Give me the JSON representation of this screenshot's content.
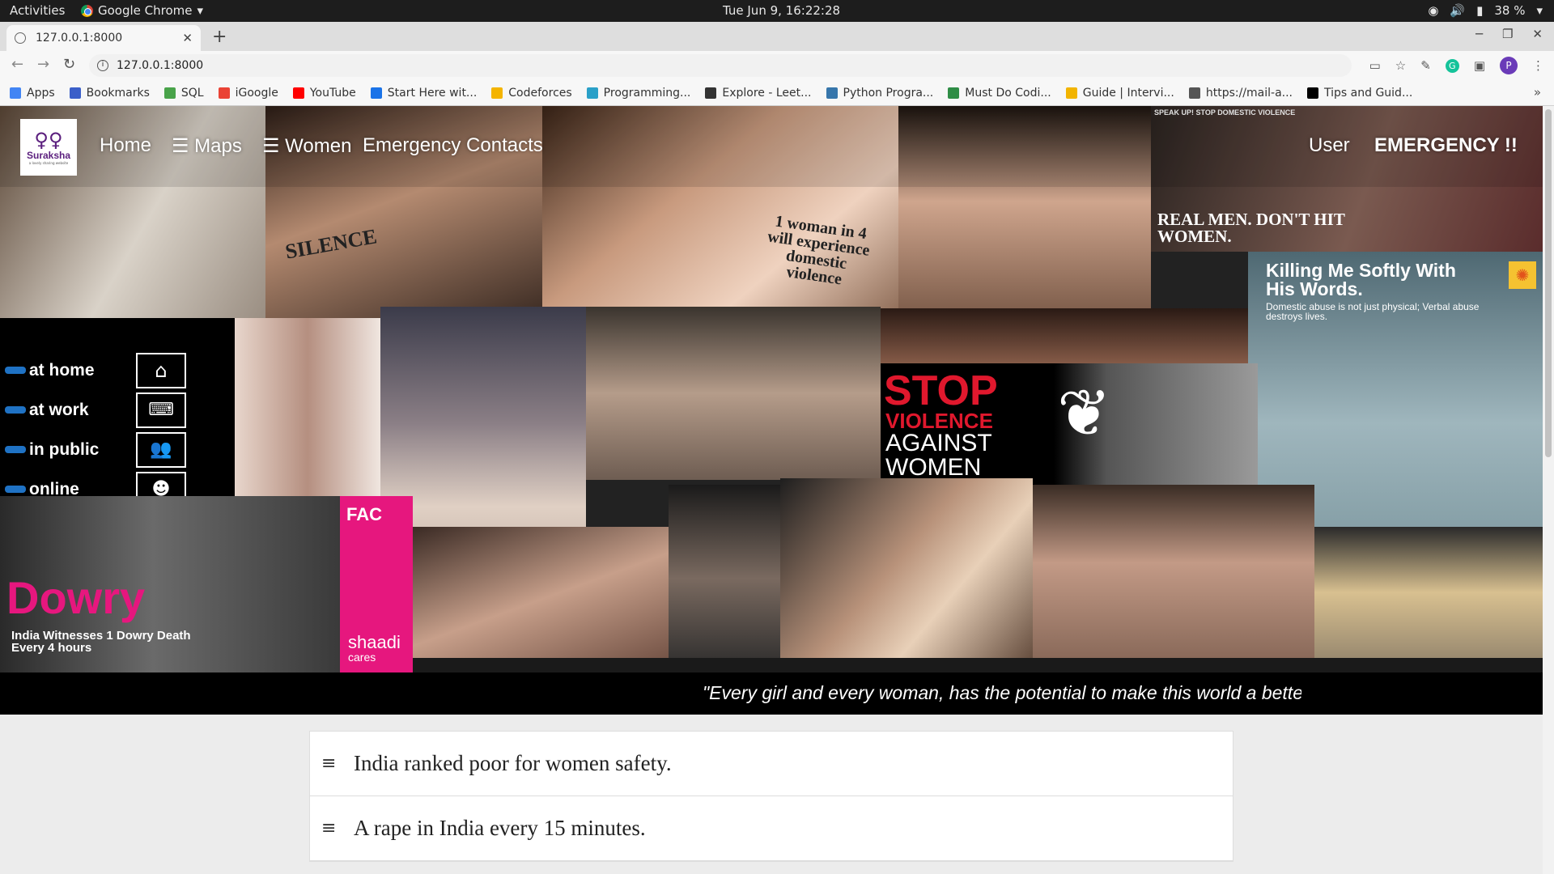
{
  "system_bar": {
    "activities": "Activities",
    "app_name": "Google Chrome",
    "clock": "Tue Jun  9, 16:22:28",
    "battery": "38 %"
  },
  "browser": {
    "tab_title": "127.0.0.1:8000",
    "url": "127.0.0.1:8000",
    "profile_initial": "P",
    "bookmarks": [
      {
        "label": "Apps",
        "color": "#4285f4"
      },
      {
        "label": "Bookmarks",
        "color": "#3b5fc9"
      },
      {
        "label": "SQL",
        "color": "#49a34a"
      },
      {
        "label": "iGoogle",
        "color": "#ea4335"
      },
      {
        "label": "YouTube",
        "color": "#ff0000"
      },
      {
        "label": "Start Here wit...",
        "color": "#1a73e8"
      },
      {
        "label": "Codeforces",
        "color": "#f4b400"
      },
      {
        "label": "Programming...",
        "color": "#2aa0c8"
      },
      {
        "label": "Explore - Leet...",
        "color": "#333333"
      },
      {
        "label": "Python Progra...",
        "color": "#3776ab"
      },
      {
        "label": "Must Do Codi...",
        "color": "#2f8d46"
      },
      {
        "label": "Guide | Intervi...",
        "color": "#f2b400"
      },
      {
        "label": "https://mail-a...",
        "color": "#555555"
      },
      {
        "label": "Tips and Guid...",
        "color": "#000000"
      }
    ]
  },
  "site": {
    "logo_name": "Suraksha",
    "logo_tagline": "a lovely sharing website",
    "nav": {
      "home": "Home",
      "maps": "☰ Maps",
      "women": "☰ Women",
      "emergency_contacts": "Emergency Contacts",
      "user": "User",
      "emergency": "EMERGENCY !!"
    },
    "collage_text": {
      "silence": "SILENCE",
      "one_in_four": "1 woman in 4 will experience domestic violence",
      "real_men": "REAL MEN. DON'T HIT WOMEN.",
      "speak_up": "SPEAK UP! STOP DOMESTIC VIOLENCE",
      "killing_softly": "Killing Me Softly With His Words.",
      "killing_sub": "Domestic abuse is not just physical; Verbal abuse destroys lives.",
      "at_home": "at home",
      "at_work": "at work",
      "in_public": "in public",
      "online": "online",
      "stop": "STOP",
      "violence": "VIOLENCE",
      "against": "AGAINST",
      "women": "WOMEN",
      "facts": "FAC",
      "dowry": "Dowry",
      "dowry_sub": "India Witnesses 1 Dowry Death Every 4 hours",
      "shaadi": "shaadi",
      "shaadi_sub": "cares"
    },
    "quote": "\"Every girl and every woman, has the potential to make this world a better place.\"",
    "facts": [
      "India ranked poor for women safety.",
      "A rape in India every 15 minutes."
    ],
    "colors": {
      "brand_purple": "#5b1f7e",
      "stop_red": "#e0182d",
      "dowry_pink": "#e6177e"
    }
  }
}
